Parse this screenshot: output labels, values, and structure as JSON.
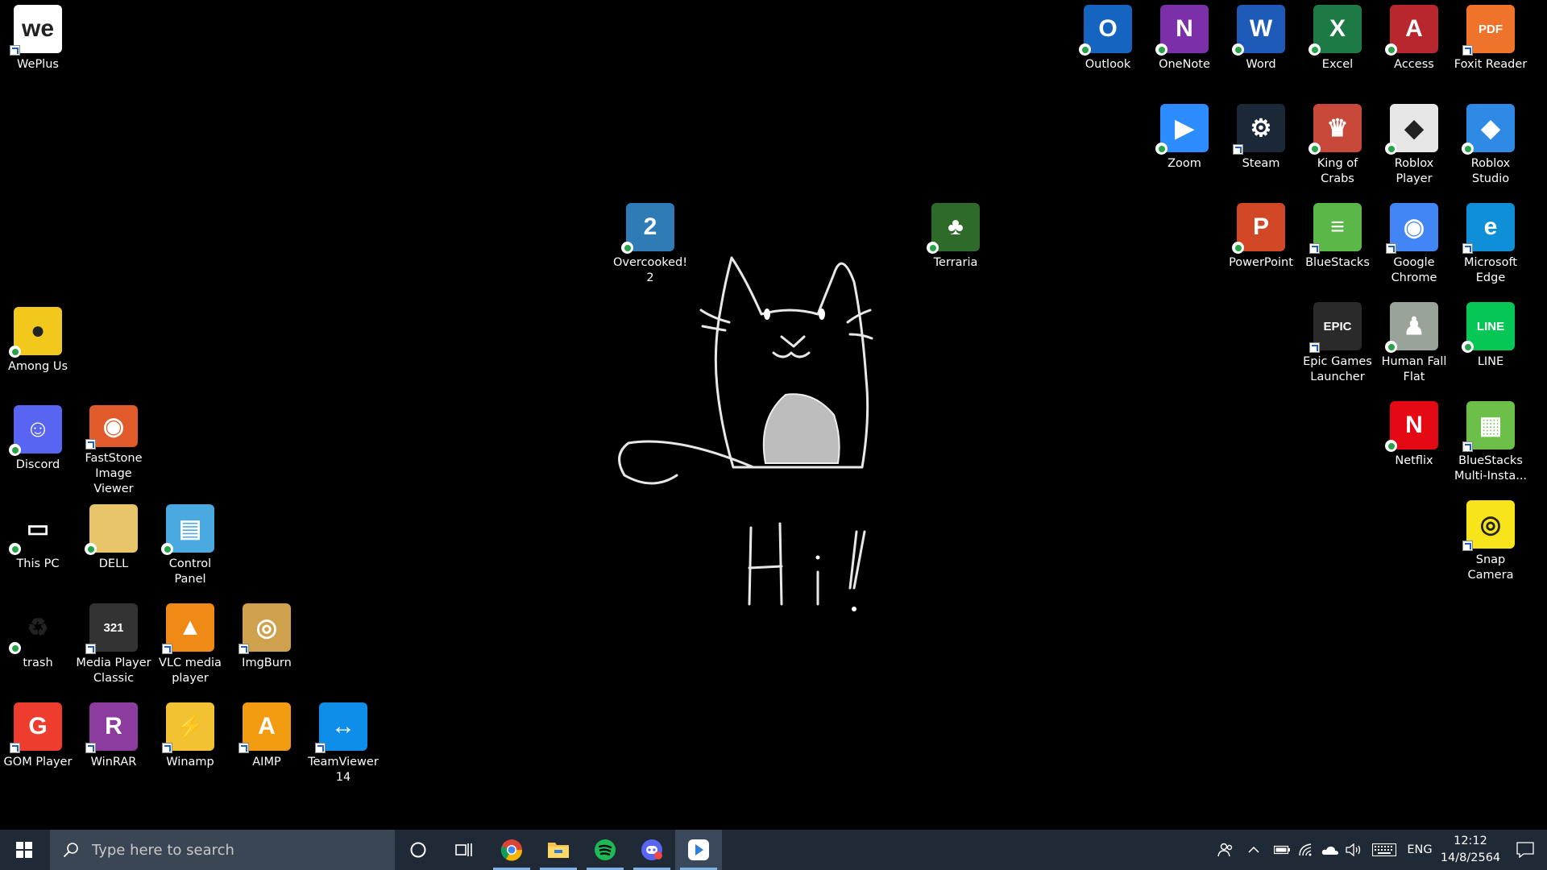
{
  "desktop": {
    "background": "#000000",
    "wallpaper_text": "Hi!",
    "icons": [
      {
        "label": "WePlus",
        "icon": "weplus-icon",
        "color": "#ffffff"
      },
      {
        "label": "Among Us",
        "icon": "among-us-icon",
        "color": "#f2c81d"
      },
      {
        "label": "Discord",
        "icon": "discord-icon",
        "color": "#5865f2"
      },
      {
        "label": "FastStone Image Viewer",
        "icon": "faststone-icon",
        "color": "#e05a2a"
      },
      {
        "label": "This PC",
        "icon": "this-pc-icon",
        "color": "#3aa0ea"
      },
      {
        "label": "DELL",
        "icon": "folder-icon",
        "color": "#e8c56a"
      },
      {
        "label": "Control Panel",
        "icon": "control-panel-icon",
        "color": "#4aa9e0"
      },
      {
        "label": "trash",
        "icon": "recycle-bin-icon",
        "color": "#bcd3e4"
      },
      {
        "label": "Media Player Classic",
        "icon": "mpc-icon",
        "color": "#333333"
      },
      {
        "label": "VLC media player",
        "icon": "vlc-icon",
        "color": "#f08a16"
      },
      {
        "label": "ImgBurn",
        "icon": "imgburn-icon",
        "color": "#cfa14d"
      },
      {
        "label": "GOM Player",
        "icon": "gom-player-icon",
        "color": "#ee3c2e"
      },
      {
        "label": "WinRAR",
        "icon": "winrar-icon",
        "color": "#8c3c9e"
      },
      {
        "label": "Winamp",
        "icon": "winamp-icon",
        "color": "#f2c233"
      },
      {
        "label": "AIMP",
        "icon": "aimp-icon",
        "color": "#f39c12"
      },
      {
        "label": "TeamViewer 14",
        "icon": "teamviewer-icon",
        "color": "#0e8ee9"
      },
      {
        "label": "Overcooked! 2",
        "icon": "overcooked-icon",
        "color": "#2f7bb6"
      },
      {
        "label": "Terraria",
        "icon": "terraria-icon",
        "color": "#2e6b2b"
      },
      {
        "label": "Outlook",
        "icon": "outlook-icon",
        "color": "#1565c0"
      },
      {
        "label": "OneNote",
        "icon": "onenote-icon",
        "color": "#7b2fa8"
      },
      {
        "label": "Word",
        "icon": "word-icon",
        "color": "#1e5bb8"
      },
      {
        "label": "Excel",
        "icon": "excel-icon",
        "color": "#1e7a45"
      },
      {
        "label": "Access",
        "icon": "access-icon",
        "color": "#b8262e"
      },
      {
        "label": "Foxit Reader",
        "icon": "foxit-icon",
        "color": "#f0732c"
      },
      {
        "label": "Zoom",
        "icon": "zoom-icon",
        "color": "#2d8cff"
      },
      {
        "label": "Steam",
        "icon": "steam-icon",
        "color": "#1b2838"
      },
      {
        "label": "King of Crabs",
        "icon": "king-of-crabs-icon",
        "color": "#c8493a"
      },
      {
        "label": "Roblox Player",
        "icon": "roblox-icon",
        "color": "#e6e6e6"
      },
      {
        "label": "Roblox Studio",
        "icon": "roblox-studio-icon",
        "color": "#2f8ae6"
      },
      {
        "label": "PowerPoint",
        "icon": "powerpoint-icon",
        "color": "#d24726"
      },
      {
        "label": "BlueStacks",
        "icon": "bluestacks-icon",
        "color": "#5bb848"
      },
      {
        "label": "Google Chrome",
        "icon": "chrome-icon",
        "color": "#4285f4"
      },
      {
        "label": "Microsoft Edge",
        "icon": "edge-icon",
        "color": "#0f8fd8"
      },
      {
        "label": "Epic Games Launcher",
        "icon": "epic-games-icon",
        "color": "#2a2a2a"
      },
      {
        "label": "Human Fall Flat",
        "icon": "human-fall-flat-icon",
        "color": "#9aa39a"
      },
      {
        "label": "LINE",
        "icon": "line-icon",
        "color": "#06c755"
      },
      {
        "label": "Netflix",
        "icon": "netflix-icon",
        "color": "#e50914"
      },
      {
        "label": "BlueStacks Multi-Insta...",
        "icon": "bluestacks-multi-icon",
        "color": "#6cc04a"
      },
      {
        "label": "Snap Camera",
        "icon": "snap-camera-icon",
        "color": "#f7e41b"
      }
    ]
  },
  "taskbar": {
    "search_placeholder": "Type here to search",
    "apps": [
      "start-icon",
      "cortana-icon",
      "task-view-icon",
      "chrome-icon",
      "file-explorer-icon",
      "spotify-icon",
      "discord-canary-icon",
      "bluestacks-taskbar-icon"
    ],
    "language": "ENG",
    "time": "12:12",
    "date": "14/8/2564"
  }
}
